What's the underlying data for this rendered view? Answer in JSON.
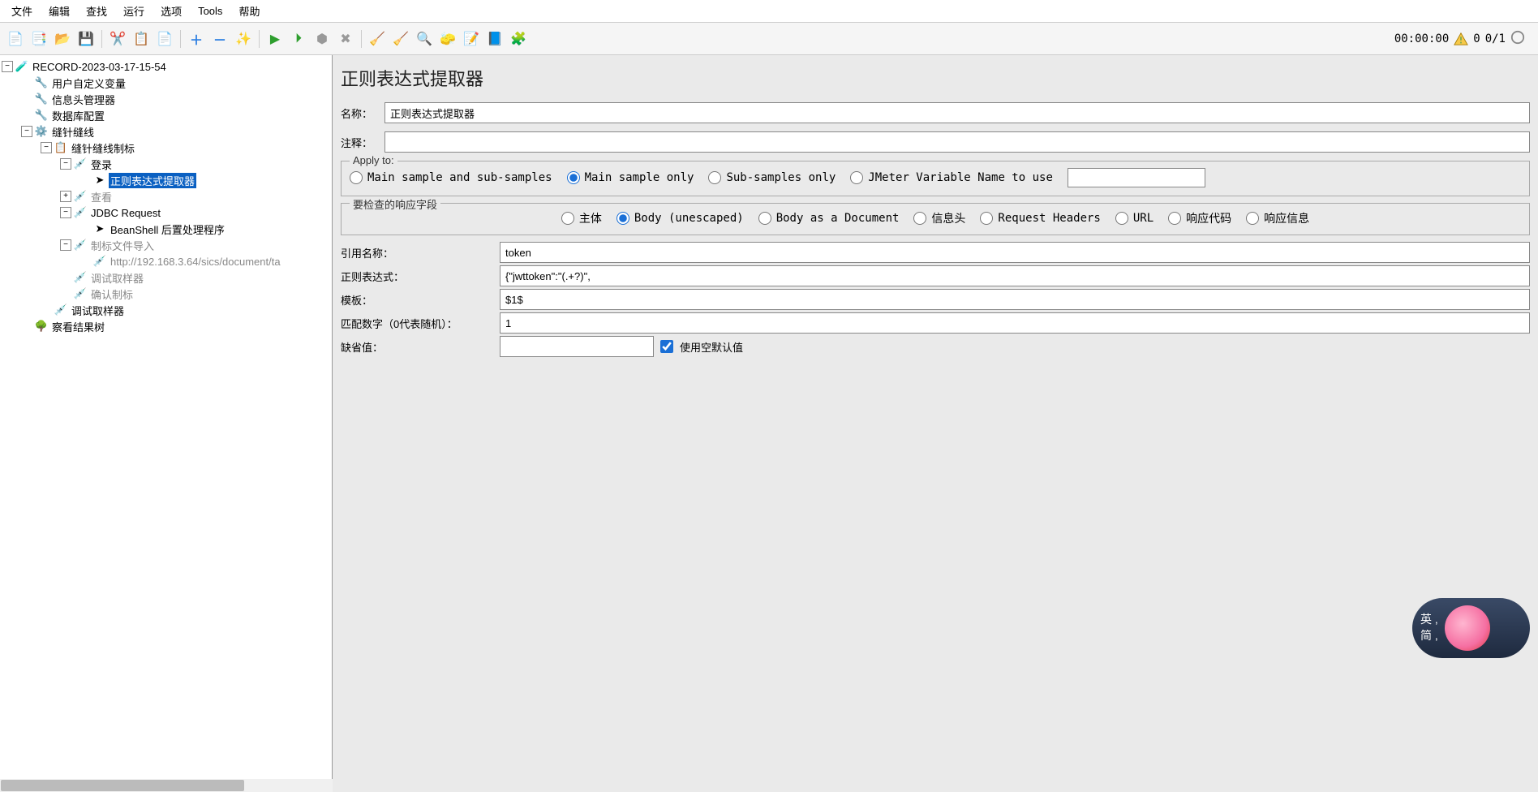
{
  "menu": [
    "文件",
    "编辑",
    "查找",
    "运行",
    "选项",
    "Tools",
    "帮助"
  ],
  "toolbar_status": {
    "time": "00:00:00",
    "left": "0",
    "right": "0/1"
  },
  "tree": {
    "root": "RECORD-2023-03-17-15-54",
    "n1": "用户自定义变量",
    "n2": "信息头管理器",
    "n3": "数据库配置",
    "n4": "缝针缝线",
    "n5": "缝针缝线制标",
    "n6": "登录",
    "n7": "正则表达式提取器",
    "n8": "查看",
    "n9": "JDBC Request",
    "n10": "BeanShell 后置处理程序",
    "n11": "制标文件导入",
    "n12": "http://192.168.3.64/sics/document/ta",
    "n13": "调试取样器",
    "n14": "确认制标",
    "n15": "调试取样器",
    "n16": "察看结果树"
  },
  "panel": {
    "title": "正则表达式提取器",
    "name_label": "名称：",
    "name_value": "正则表达式提取器",
    "comment_label": "注释：",
    "comment_value": "",
    "apply_legend": "Apply to:",
    "apply_opts": {
      "o1": "Main sample and sub-samples",
      "o2": "Main sample only",
      "o3": "Sub-samples only",
      "o4": "JMeter Variable Name to use"
    },
    "field_legend": "要检查的响应字段",
    "field_opts": {
      "f1": "主体",
      "f2": "Body (unescaped)",
      "f3": "Body as a Document",
      "f4": "信息头",
      "f5": "Request Headers",
      "f6": "URL",
      "f7": "响应代码",
      "f8": "响应信息"
    },
    "ref_label": "引用名称：",
    "ref_value": "token",
    "regex_label": "正则表达式：",
    "regex_value": "{\"jwttoken\":\"(.+?)\",",
    "tpl_label": "模板：",
    "tpl_value": "$1$",
    "match_label": "匹配数字（0代表随机）：",
    "match_value": "1",
    "default_label": "缺省值：",
    "default_value": "",
    "empty_default": "使用空默认值"
  },
  "ime": {
    "line1": "英 ,",
    "line2": "简 ,"
  }
}
